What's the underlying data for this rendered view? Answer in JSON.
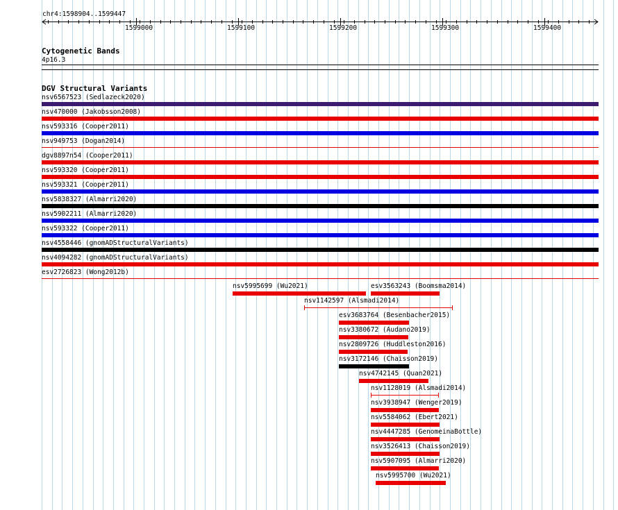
{
  "region": {
    "label": "chr4:1598904..1599447",
    "start": 1598904,
    "end": 1599447,
    "ticks": [
      "1599000",
      "1599100",
      "1599200",
      "1599300",
      "1599400"
    ]
  },
  "cytobands": {
    "title": "Cytogenetic Bands",
    "band": "4p16.3"
  },
  "dgv": {
    "title": "DGV Structural Variants",
    "colors": {
      "purple": "#3c1a6e",
      "red": "#e80000",
      "blue": "#0000e0",
      "black": "#000000",
      "separator": "#e00000",
      "grid": "#b9d7e6"
    },
    "full_rows": [
      {
        "label": "nsv6567523 (Sedlazeck2020)",
        "color": "purple"
      },
      {
        "label": "nsv470000 (Jakobsson2008)",
        "color": "red"
      },
      {
        "label": "nsv593316 (Cooper2011)",
        "color": "blue"
      },
      {
        "label": "nsv949753 (Dogan2014)",
        "color": "none"
      },
      {
        "label": "dgv8897n54 (Cooper2011)",
        "color": "red"
      },
      {
        "label": "nsv593320 (Cooper2011)",
        "color": "red"
      },
      {
        "label": "nsv593321 (Cooper2011)",
        "color": "blue"
      },
      {
        "label": "nsv5838327 (Almarri2020)",
        "color": "black"
      },
      {
        "label": "nsv5902211 (Almarri2020)",
        "color": "blue"
      },
      {
        "label": "nsv593322 (Cooper2011)",
        "color": "blue"
      },
      {
        "label": "nsv4558446 (gnomADStructuralVariants)",
        "color": "black"
      },
      {
        "label": "nsv4094282 (gnomADStructuralVariants)",
        "color": "red"
      },
      {
        "label": "esv2726823 (Wong2012b)",
        "color": "none"
      }
    ],
    "partial_features": [
      {
        "label": "nsv5995699 (Wu2021)",
        "color": "red",
        "style": "bar"
      },
      {
        "label": "esv3563243 (Boomsma2014)",
        "color": "red",
        "style": "bar"
      },
      {
        "label": "nsv1142597 (Alsmadi2014)",
        "color": "red",
        "style": "whisker"
      },
      {
        "label": "esv3683764 (Besenbacher2015)",
        "color": "red",
        "style": "bar"
      },
      {
        "label": "nsv3380672 (Audano2019)",
        "color": "red",
        "style": "bar"
      },
      {
        "label": "nsv2809726 (Huddleston2016)",
        "color": "red",
        "style": "bar"
      },
      {
        "label": "nsv3172146 (Chaisson2019)",
        "color": "black",
        "style": "bar"
      },
      {
        "label": "nsv4742145 (Quan2021)",
        "color": "red",
        "style": "bar"
      },
      {
        "label": "nsv1128019 (Alsmadi2014)",
        "color": "red",
        "style": "whisker"
      },
      {
        "label": "nsv3938947 (Wenger2019)",
        "color": "red",
        "style": "bar"
      },
      {
        "label": "nsv5584062 (Ebert2021)",
        "color": "red",
        "style": "bar"
      },
      {
        "label": "nsv4447285 (GenomeinaBottle)",
        "color": "red",
        "style": "bar"
      },
      {
        "label": "nsv3526413 (Chaisson2019)",
        "color": "red",
        "style": "bar"
      },
      {
        "label": "nsv5907095 (Almarri2020)",
        "color": "red",
        "style": "bar"
      },
      {
        "label": "nsv5995700 (Wu2021)",
        "color": "red",
        "style": "bar"
      }
    ]
  }
}
